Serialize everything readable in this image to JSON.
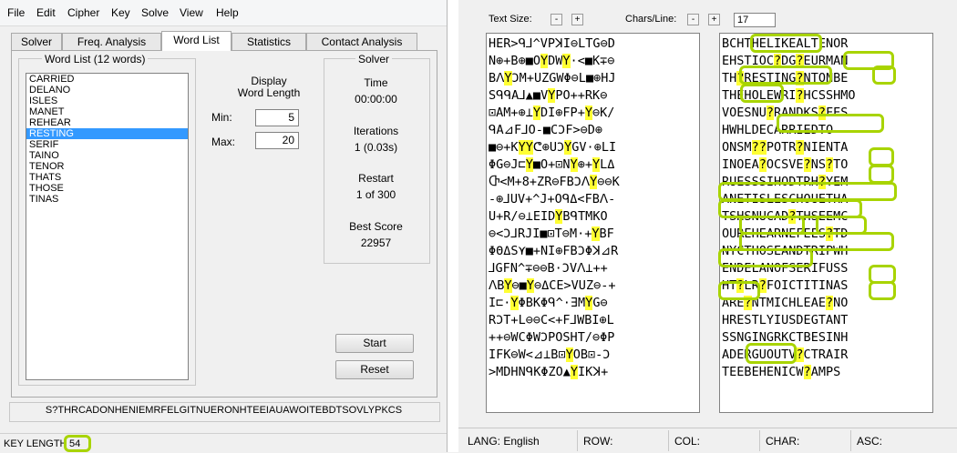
{
  "menu": [
    "File",
    "Edit",
    "Cipher",
    "Key",
    "Solve",
    "View",
    "Help"
  ],
  "tabs": [
    "Solver",
    "Freq. Analysis",
    "Word List",
    "Statistics",
    "Contact Analysis"
  ],
  "word_list": {
    "title": "Word List (12 words)",
    "items": [
      "CARRIED",
      "DELANO",
      "ISLES",
      "MANET",
      "REHEAR",
      "RESTING",
      "SERIF",
      "TAINO",
      "TENOR",
      "THATS",
      "THOSE",
      "TINAS"
    ],
    "selected": "RESTING"
  },
  "display": {
    "heading_line1": "Display",
    "heading_line2": "Word Length",
    "min_label": "Min:",
    "min_value": "5",
    "max_label": "Max:",
    "max_value": "20"
  },
  "solver": {
    "title": "Solver",
    "time_label": "Time",
    "time_value": "00:00:00",
    "iterations_label": "Iterations",
    "iterations_value": "1 (0.03s)",
    "restart_label": "Restart",
    "restart_value": "1 of 300",
    "best_score_label": "Best Score",
    "best_score_value": "22957",
    "start_label": "Start",
    "reset_label": "Reset"
  },
  "key_string": "S?THRCADONHENIEMRFELGITNUERONHTEEIAUAWOITEBDTSOVLYPKCS",
  "status_left": {
    "key_length_label": "KEY LENGTH",
    "key_length_value": "54"
  },
  "toolbar": {
    "text_size_label": "Text Size:",
    "chars_per_line_label": "Chars/Line:",
    "chars_per_line_value": "17",
    "minus": "-",
    "plus": "+"
  },
  "cipher_lines": [
    "HER>ᑫ⅃^VPꓘI⊖LTG⊖D",
    "N⊕+B⊕■OYDWY·<■K∓⊖",
    "BꓥYϽM+UZGWΦ⊖L■⊕HJ",
    "SᑫᑫA⅃▲■VYPO++RK⊖",
    "⊡AM+⊕⊥YDI⊕FP+Y⊖K/",
    "ᑫA⊿F⅃O-■CϽF>⊖D⊕",
    "■⊖+KYYᕦ⊕UϽYGV·⊕LI",
    "ΦG⊖J⊏Y■O+⊡NY⊕+YLΔ",
    "Ⴇ<M+8+ZR⊖FBϽꓥY⊖⊖K",
    "-⊕⅃UV+^J+OᑫΔ<FBꓥ-",
    "U+R/⊖⊥EIDYBᑫTMKO",
    "⊖<Ͻ⅃RJI■⊡T⊖M·+YBF",
    "ΦΘΔS⋎■+NI⊕FBϽΦꓘ⊿R",
    "⅃GFN^∓⊖⊖B·ϽVꓥ⊥++",
    "ꓥBY⊖■Y⊖ΔCE>VUZ⊖-+",
    "I⊏·YΦBKΦᑫ^·∃MYG⊖",
    "RϽT+L⊖⊖C<+F⅃WBI⊕L",
    "++⊖WCΦWϽPOSHT/⊖ΦP",
    "IFK⊖W<⊿⊥B⊡YOB⊡-Ͻ",
    ">MDHNᑫKΦZO▲YIKꓘ+"
  ],
  "plain_lines": [
    "BCHTHELIKEALTENOR",
    "EHSTIOC?DG?EURMAN",
    "TH?RESTING?NTONBE",
    "THEHOLEWRI?HCSSHMO",
    "VOESNU?RANDKS?FES",
    "HWHLDECARRIEDTO",
    "ONSM??POTR?NIENTA",
    "INOEA?OCSVE?NS?TO",
    "RUESSSIHODTRH?YEM",
    "ANETISLESCHOUETHA",
    "TSHSNUCAD?THSEEMC",
    "OUREHEARNEFEES?TD",
    "NYCTHOSEANDTRIPWH",
    "ENDELANOFSERIFUSS",
    "HT?LR?FOICTITINAS",
    "ARE?NTMICHLEAE?NO",
    "HRESTLYIUSDEGTANT",
    "SSNGINGRKCTBESINH",
    "ADERGUOUTV?CTRAIR",
    "TEEBEHENICW?AMPS"
  ],
  "status_right": {
    "lang_label": "LANG: English",
    "row_label": "ROW:",
    "col_label": "COL:",
    "char_label": "CHAR:",
    "asc_label": "ASC:"
  },
  "colors": {
    "highlight": "#a8d400",
    "yellow_mark": "#ffff33",
    "selection": "#3399ff"
  }
}
